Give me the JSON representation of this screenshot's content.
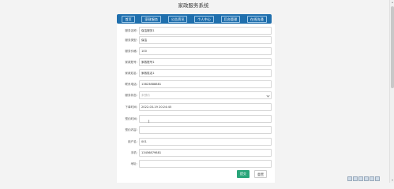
{
  "header": {
    "title": "家政服务系统"
  },
  "nav": {
    "items": [
      {
        "label": "首页"
      },
      {
        "label": "家政服务"
      },
      {
        "label": "公告资讯"
      },
      {
        "label": "个人中心"
      },
      {
        "label": "后台管理"
      },
      {
        "label": "在线沟通"
      }
    ]
  },
  "form": {
    "fields": [
      {
        "label": "服务名称:",
        "value": "保洁服务1"
      },
      {
        "label": "服务类型:",
        "value": "保洁"
      },
      {
        "label": "服务价格:",
        "value": "100"
      },
      {
        "label": "家政账号:",
        "value": "家政账号1"
      },
      {
        "label": "家政姓名:",
        "value": "家政姓名1"
      },
      {
        "label": "联系电话:",
        "value": "13823888881"
      },
      {
        "label": "服务状态:",
        "value": "未预约",
        "type": "select"
      },
      {
        "label": "下单时间:",
        "value": "2022-03-19 20:24:45"
      },
      {
        "label": "预约时间:",
        "value": ""
      },
      {
        "label": "预约内容:",
        "value": ""
      },
      {
        "label": "用户名:",
        "value": "001"
      },
      {
        "label": "手机:",
        "value": "13456879881"
      },
      {
        "label": "地址:",
        "value": ""
      }
    ],
    "submit_label": "提交",
    "reset_label": "重置"
  }
}
